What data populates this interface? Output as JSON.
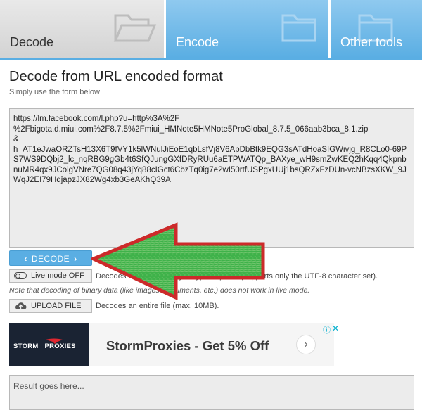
{
  "tabs": [
    {
      "label": "Decode",
      "active": true
    },
    {
      "label": "Encode",
      "active": false
    },
    {
      "label": "Other tools",
      "active": false
    }
  ],
  "heading": {
    "title": "Decode from URL encoded format",
    "subtitle": "Simply use the form below"
  },
  "input": {
    "value": "https://lm.facebook.com/l.php?u=http%3A%2F\n%2Fbigota.d.miui.com%2F8.7.5%2Fmiui_HMNote5HMNote5ProGlobal_8.7.5_066aab3bca_8.1.zip\n&\nh=AT1eJwaORZTsH13X6T9fVY1k5lWNulJiEoE1qbLsfVj8V6ApDbBtk9EQG3sATdHoaSIGWivjg_R8CLo0-69PS7WS9DQbj2_lc_nqRBG9gGb4t6SfQJungGXfDRyRUu6aETPWATQp_BAXye_wH9smZwKEQ2hKqq4QkpnbnuMR4qx9JColgVNre7QG08q43jYq88cIGct6CbzTq0ig7e2wI50rtfUSPgxUUj1bsQRZxFzDUn-vcNBzsXKW_9JWqJ2EI79HqjapzJX82Wg4xb3GeAKhQ39A"
  },
  "decode_button": {
    "label": "DECODE",
    "left_icon": "chevron-left-icon",
    "right_icon": "chevron-right-icon"
  },
  "live_mode": {
    "label": "Live mode OFF",
    "icon": "toggle-icon",
    "description": "Decodes in real-time as you type or paste (supports only the UTF-8 character set).",
    "note": "Note that decoding of binary data (like images, documents, etc.) does not work in live mode."
  },
  "upload": {
    "label": "UPLOAD FILE",
    "icon": "cloud-upload-icon",
    "description": "Decodes an entire file (max. 10MB)."
  },
  "ad": {
    "brand": "STORM",
    "brand_accent": "PROXIES",
    "headline": "StormProxies - Get 5% Off",
    "info_icon": "ⓘ",
    "close_icon": "✕",
    "arrow": "›"
  },
  "result": {
    "placeholder": "Result goes here..."
  },
  "colors": {
    "accent": "#5aaee3",
    "arrow_fill": "#3fb24a",
    "arrow_border": "#cc2a2a"
  }
}
